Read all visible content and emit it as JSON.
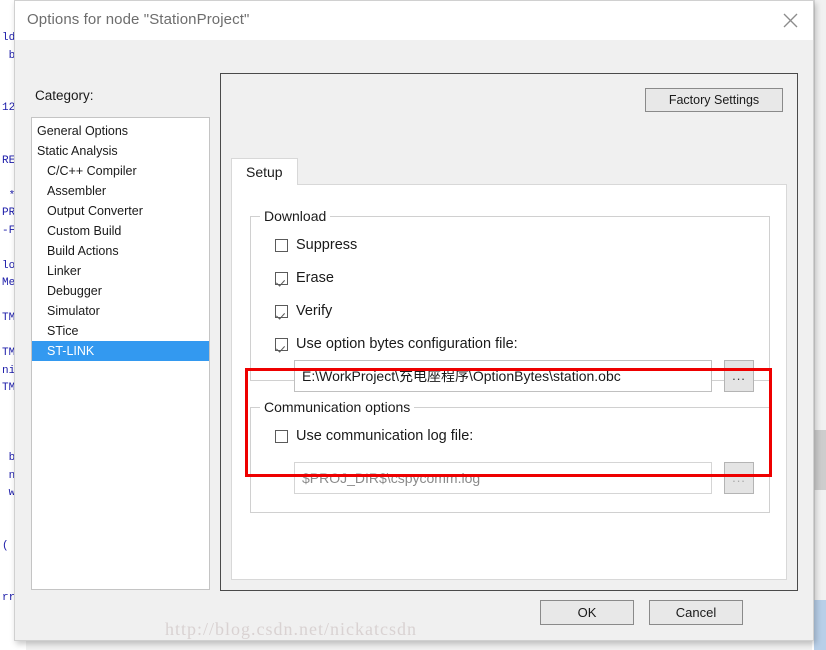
{
  "window": {
    "title": "Options for node \"StationProject\"",
    "close_icon": "close-icon"
  },
  "background": {
    "code_fragments": "ld\n b\n\n\n12\n\n\nRE\n\n *\nPR\n-F\n\nlo\nMe\n\nTM\n\nTM\nni\nTM\n\n\n\n b\n n\n w\n\n\n(\n\n\nrr"
  },
  "category": {
    "label": "Category:",
    "items": [
      {
        "label": "General Options",
        "indent": false,
        "selected": false
      },
      {
        "label": "Static Analysis",
        "indent": false,
        "selected": false
      },
      {
        "label": "C/C++ Compiler",
        "indent": true,
        "selected": false
      },
      {
        "label": "Assembler",
        "indent": true,
        "selected": false
      },
      {
        "label": "Output Converter",
        "indent": true,
        "selected": false
      },
      {
        "label": "Custom Build",
        "indent": true,
        "selected": false
      },
      {
        "label": "Build Actions",
        "indent": true,
        "selected": false
      },
      {
        "label": "Linker",
        "indent": true,
        "selected": false
      },
      {
        "label": "Debugger",
        "indent": true,
        "selected": false
      },
      {
        "label": "Simulator",
        "indent": true,
        "selected": false
      },
      {
        "label": "STice",
        "indent": true,
        "selected": false
      },
      {
        "label": "ST-LINK",
        "indent": true,
        "selected": true
      }
    ]
  },
  "panel": {
    "factory_settings_label": "Factory Settings",
    "tabs": [
      {
        "label": "Setup",
        "active": true
      }
    ]
  },
  "download": {
    "group_title": "Download",
    "options": [
      {
        "label": "Suppress",
        "checked": false
      },
      {
        "label": "Erase",
        "checked": true
      },
      {
        "label": "Verify",
        "checked": true
      }
    ],
    "option_bytes": {
      "label": "Use option bytes configuration file:",
      "checked": true,
      "path": "E:\\WorkProject\\充电座程序\\OptionBytes\\station.obc",
      "browse_label": "...",
      "disabled": false
    }
  },
  "communication": {
    "group_title": "Communication options",
    "log_file": {
      "label": "Use communication log file:",
      "checked": false,
      "path": "$PROJ_DIR$\\cspycomm.log",
      "browse_label": "...",
      "disabled": true
    }
  },
  "footer": {
    "ok_label": "OK",
    "cancel_label": "Cancel"
  },
  "annotation": {
    "highlight_color": "#ee0000"
  },
  "watermark": {
    "text": "http://blog.csdn.net/nickatcsdn"
  }
}
